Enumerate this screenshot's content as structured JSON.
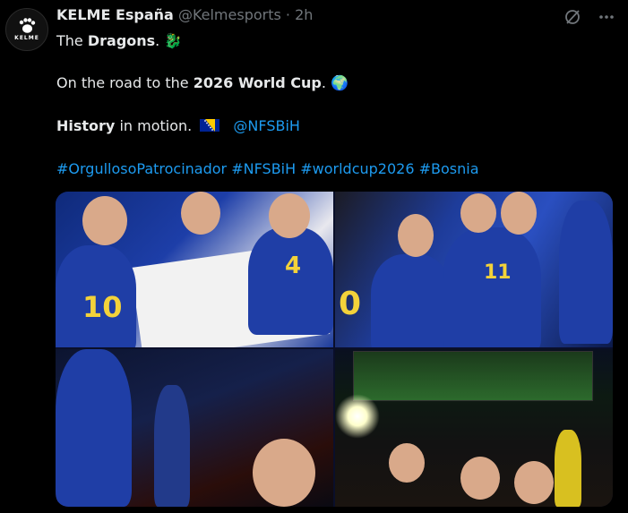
{
  "tweet": {
    "author_name": "KELME España",
    "handle": "@Kelmesports",
    "separator": "·",
    "time": "2h",
    "avatar_text": "KELME",
    "line1_pre": "The ",
    "line1_bold": "Dragons",
    "line1_post": ".",
    "line1_emoji": "🐉",
    "line2_pre": "On the road to the ",
    "line2_bold": "2026 World Cup",
    "line2_post": ".",
    "line2_emoji": "🌍",
    "line3_bold": "History",
    "line3_post": " in motion.",
    "line3_mention": "@NFSBiH",
    "hashtags": [
      "#OrgullosoPatrocinador",
      "#NFSBiH",
      "#worldcup2026",
      "#Bosnia"
    ],
    "media_numbers": [
      "10",
      "4",
      "0",
      "11"
    ]
  },
  "icons": {
    "grok": "grok-icon",
    "more": "more-icon",
    "flag": "bosnia-flag-icon"
  },
  "colors": {
    "background": "#000000",
    "text": "#e7e9ea",
    "muted": "#71767b",
    "link": "#1d9bf0"
  }
}
